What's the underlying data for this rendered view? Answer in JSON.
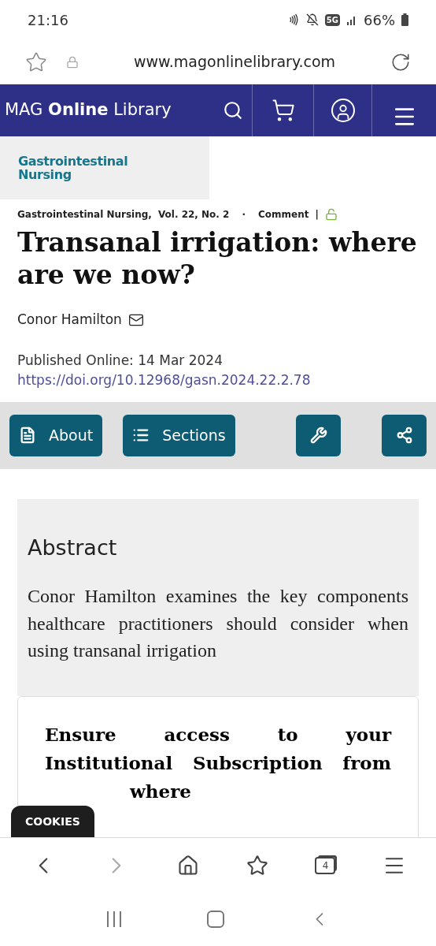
{
  "status_bar": {
    "time": "21:16",
    "network": "5G",
    "battery": "66%"
  },
  "address_bar": {
    "url": "www.magonlinelibrary.com"
  },
  "site_header": {
    "brand_prefix": "MAG",
    "brand_bold": "Online",
    "brand_suffix": "Library"
  },
  "journal_logo": {
    "line1": "Gastrointestinal",
    "line2": "Nursing"
  },
  "article": {
    "journal": "Gastrointestinal Nursing,",
    "issue": "Vol. 22, No. 2",
    "separator": "·",
    "type": "Comment",
    "divider": "|",
    "open_access": true,
    "title": "Transanal irrigation: where are we now?",
    "author": "Conor Hamilton",
    "published": "Published Online: 14 Mar 2024",
    "doi": "https://doi.org/10.12968/gasn.2024.22.2.78"
  },
  "toolbar": {
    "buttons": [
      {
        "label": "About",
        "kind": "document"
      },
      {
        "label": "Sections",
        "kind": "list"
      },
      {
        "kind": "wrench"
      },
      {
        "kind": "share"
      }
    ]
  },
  "abstract": {
    "heading": "Abstract",
    "text": "Conor Hamilton examines the key components healthcare practitioners should consider when using transanal irrigation"
  },
  "access_card": {
    "heading": "Ensure access to your Institutional Subscription from",
    "heading_end": "where"
  },
  "cookies_button": "COOKIES",
  "browser_nav": {
    "tab_count": "4",
    "forward_disabled": true
  }
}
